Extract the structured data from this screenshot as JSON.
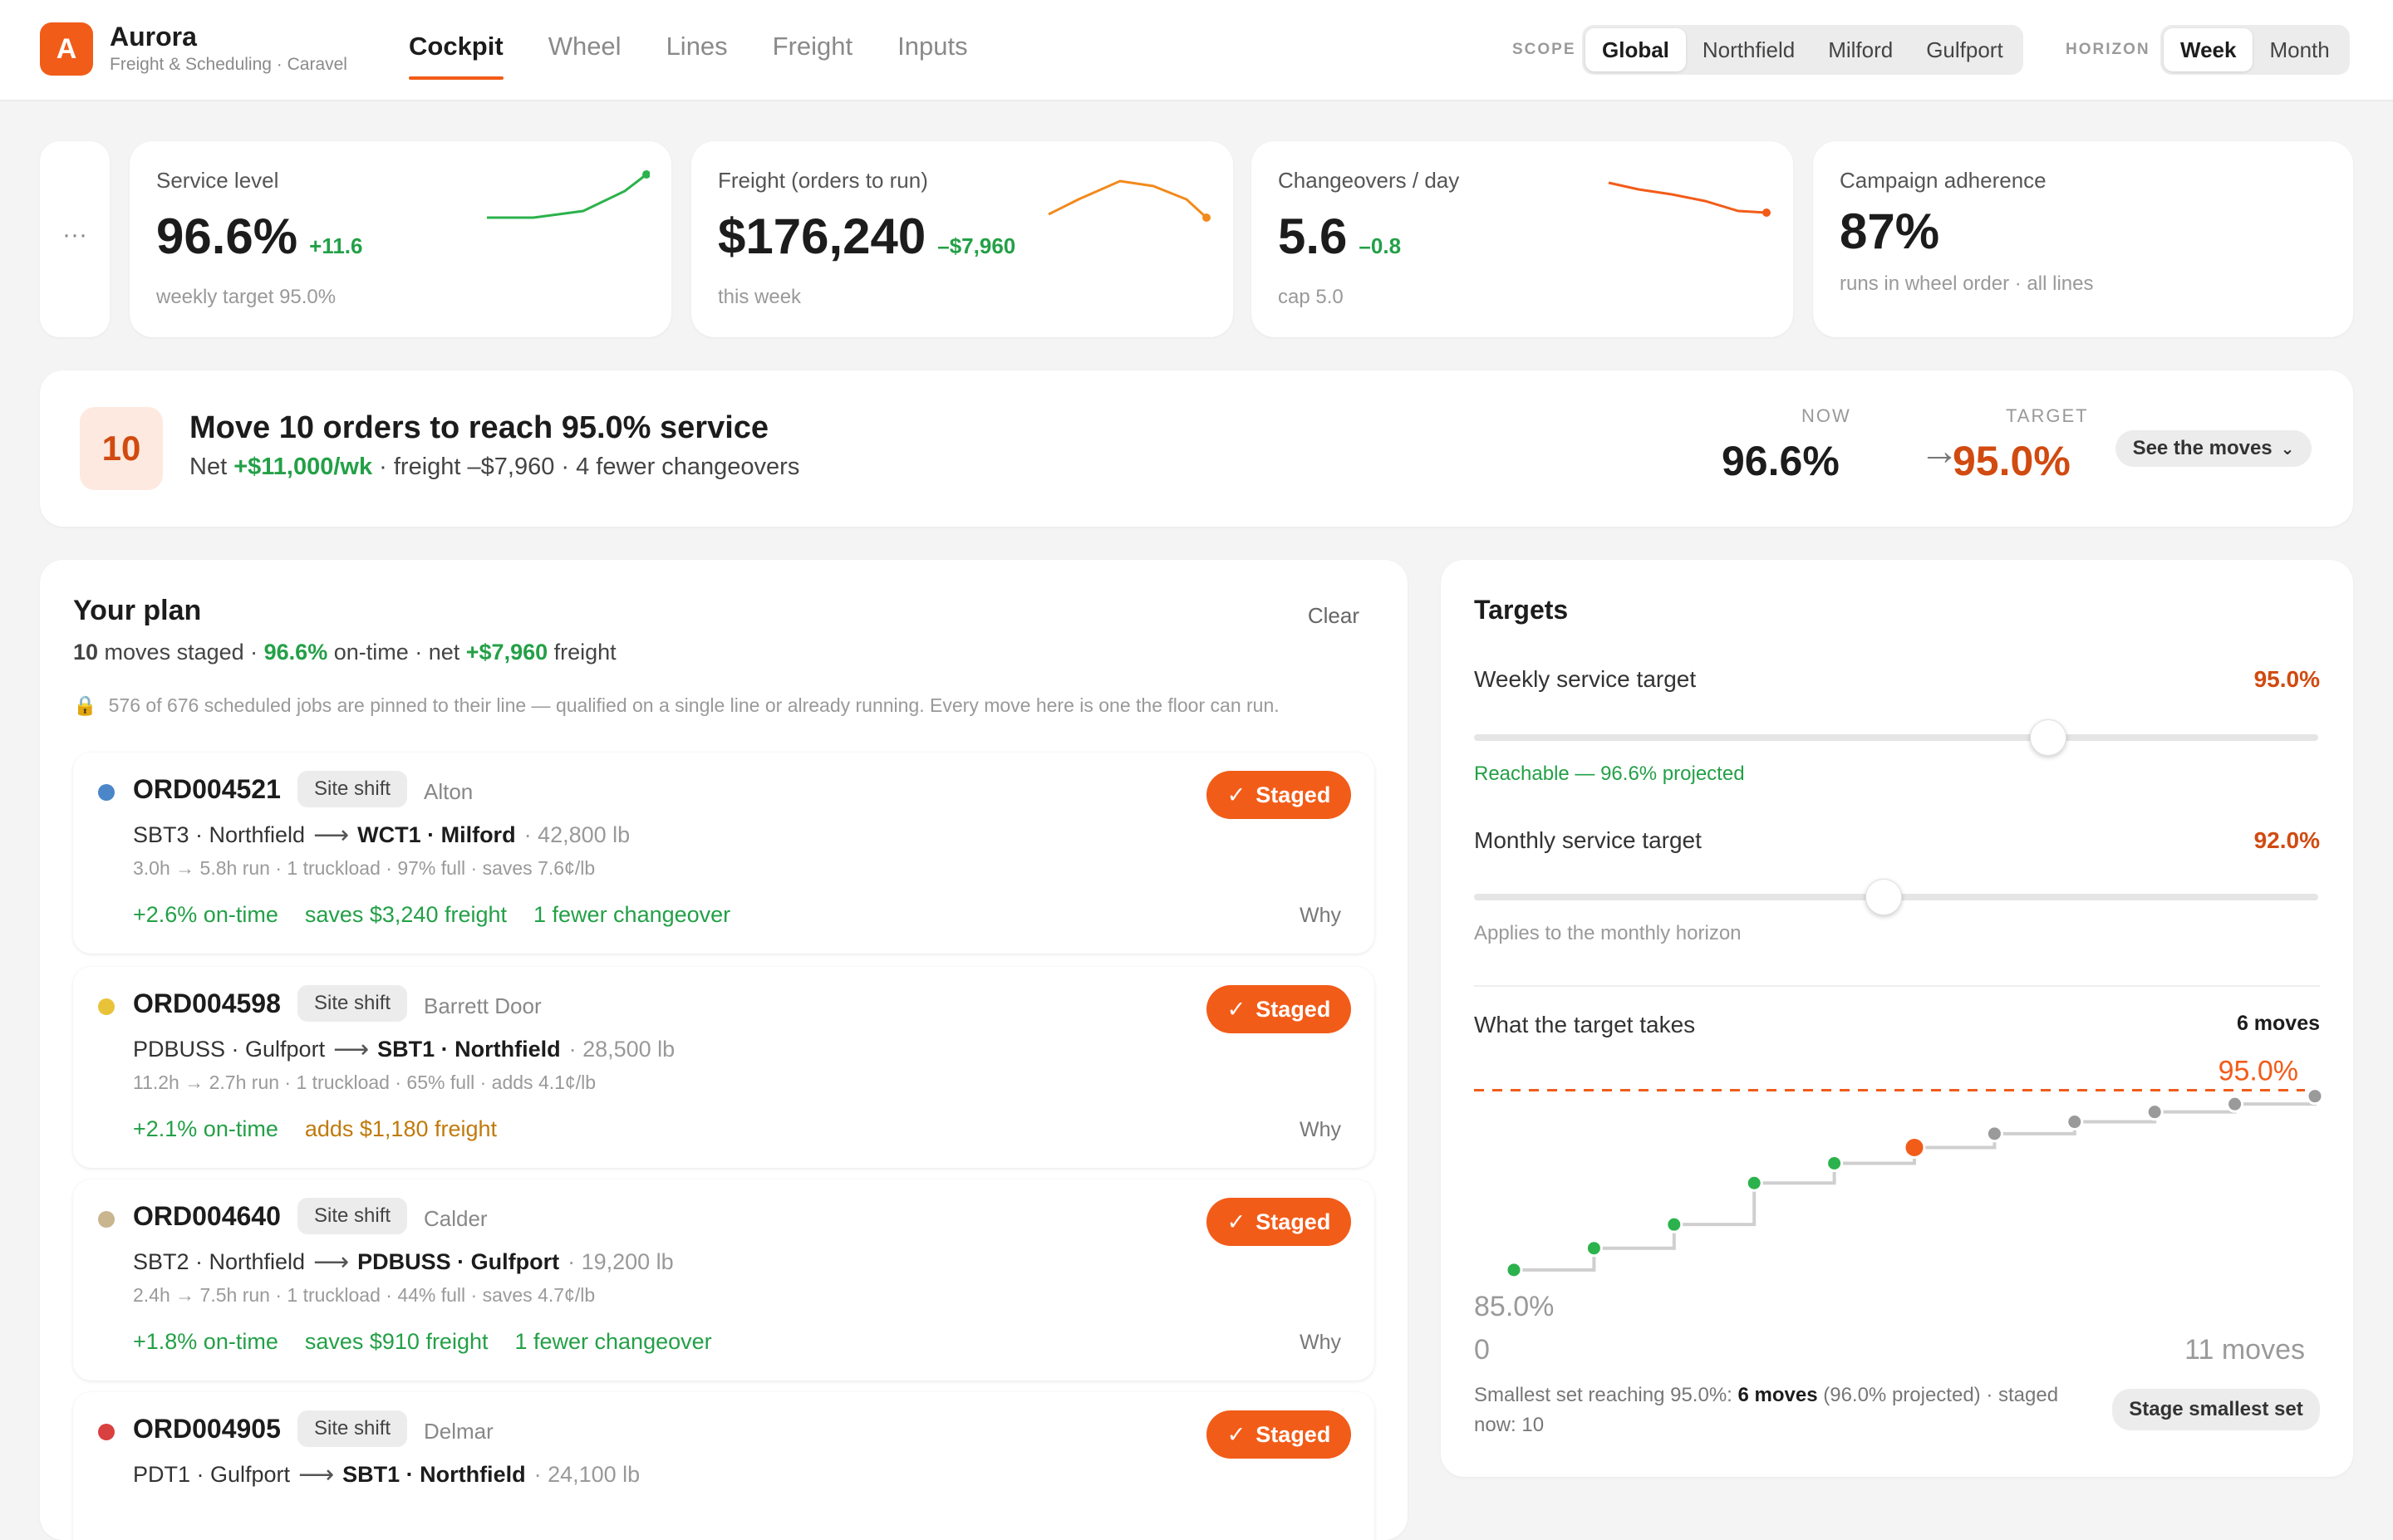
{
  "app": {
    "logo_letter": "A",
    "name": "Aurora",
    "subtitle": "Freight & Scheduling · Caravel"
  },
  "nav": {
    "tabs": [
      "Cockpit",
      "Wheel",
      "Lines",
      "Freight",
      "Inputs"
    ],
    "active": "Cockpit"
  },
  "scope": {
    "label": "SCOPE",
    "options": [
      "Global",
      "Northfield",
      "Milford",
      "Gulfport"
    ],
    "selected": "Global"
  },
  "horizon": {
    "label": "HORIZON",
    "options": [
      "Week",
      "Month"
    ],
    "selected": "Week"
  },
  "kpis": {
    "more_label": "···",
    "service": {
      "label": "Service level",
      "value": "96.6%",
      "delta": "+11.6",
      "sub": "weekly target 95.0%",
      "spark_color": "#2bb24c"
    },
    "freight": {
      "label": "Freight (orders to run)",
      "value": "$176,240",
      "delta": "–$7,960",
      "sub": "this week",
      "spark_color": "#f28a1c"
    },
    "changeovers": {
      "label": "Changeovers / day",
      "value": "5.6",
      "delta": "–0.8",
      "sub": "cap 5.0",
      "spark_color": "#f25c19"
    },
    "adherence": {
      "label": "Campaign adherence",
      "value": "87%",
      "sub": "runs in wheel order · all lines"
    }
  },
  "banner": {
    "count": "10",
    "title": "Move 10 orders to reach 95.0% service",
    "net_prefix": "Net ",
    "net_value": "+$11,000/wk",
    "net_rest": " · freight –$7,960 · 4 fewer changeovers",
    "now_label": "NOW",
    "now_value": "96.6%",
    "target_label": "TARGET",
    "target_value": "95.0%",
    "button": "See the moves"
  },
  "plan": {
    "title": "Your plan",
    "clear": "Clear",
    "summary": {
      "moves": "10",
      "moves_rest": " moves staged · ",
      "ontime": "96.6%",
      "ontime_rest": " on-time · net ",
      "freight": "+$7,960",
      "freight_rest": " freight"
    },
    "note": "576 of 676 scheduled jobs are pinned to their line — qualified on a single line or already running. Every move here is one the floor can run.",
    "staged_label": "Staged",
    "why_label": "Why",
    "orders": [
      {
        "id": "ORD004521",
        "chip": "Site shift",
        "customer": "Alton",
        "dot": "#4a86c8",
        "from": "SBT3 · Northfield",
        "to": "WCT1 · Milford",
        "weight": "· 42,800 lb",
        "stats": "3.0h → 5.8h run · 1 truckload · 97% full · saves 7.6¢/lb",
        "ontime": "+2.6% on-time",
        "freight": "saves $3,240 freight",
        "freight_color": "#23a047",
        "changeover": "1 fewer changeover"
      },
      {
        "id": "ORD004598",
        "chip": "Site shift",
        "customer": "Barrett Door",
        "dot": "#e8c33a",
        "from": "PDBUSS · Gulfport",
        "to": "SBT1 · Northfield",
        "weight": "· 28,500 lb",
        "stats": "11.2h → 2.7h run · 1 truckload · 65% full · adds 4.1¢/lb",
        "ontime": "+2.1% on-time",
        "freight": "adds $1,180 freight",
        "freight_color": "#c07a0c",
        "changeover": ""
      },
      {
        "id": "ORD004640",
        "chip": "Site shift",
        "customer": "Calder",
        "dot": "#c9b58e",
        "from": "SBT2 · Northfield",
        "to": "PDBUSS · Gulfport",
        "weight": "· 19,200 lb",
        "stats": "2.4h → 7.5h run · 1 truckload · 44% full · saves 4.7¢/lb",
        "ontime": "+1.8% on-time",
        "freight": "saves $910 freight",
        "freight_color": "#23a047",
        "changeover": "1 fewer changeover"
      },
      {
        "id": "ORD004905",
        "chip": "Site shift",
        "customer": "Delmar",
        "dot": "#d94040",
        "from": "PDT1 · Gulfport",
        "to": "SBT1 · Northfield",
        "weight": "· 24,100 lb",
        "stats": "",
        "ontime": "",
        "freight": "",
        "freight_color": "#23a047",
        "changeover": ""
      }
    ]
  },
  "targets": {
    "title": "Targets",
    "weekly": {
      "label": "Weekly service target",
      "value": "95.0%",
      "level": 0.68,
      "note": "Reachable — 96.6% projected"
    },
    "monthly": {
      "label": "Monthly service target",
      "value": "92.0%",
      "level": 0.485,
      "note": "Applies to the monthly horizon"
    },
    "takes": {
      "label": "What the target takes",
      "moves": "6 moves"
    },
    "footer": {
      "prefix": "Smallest set reaching 95.0%: ",
      "bold": "6 moves",
      "rest": " (96.0% projected) · staged now: 10"
    },
    "stage_button": "Stage smallest set"
  },
  "chart_data": {
    "type": "line",
    "step": true,
    "x_start_label": "0",
    "x_end_label": "11 moves",
    "y_low_label": "85.0%",
    "target_label": "95.0%",
    "x": [
      1,
      2,
      3,
      4,
      5,
      6,
      7,
      8,
      9,
      10,
      11
    ],
    "y": [
      85.9,
      87.0,
      88.2,
      90.3,
      91.3,
      92.1,
      92.8,
      93.4,
      93.9,
      94.3,
      94.7
    ],
    "target": 95.0,
    "reaching_index": 5,
    "colors": {
      "staged": "#2bb24c",
      "reach": "#f25c19",
      "rest": "#9a9a9a",
      "line": "#cfcfcf",
      "target": "#f25c19"
    }
  }
}
